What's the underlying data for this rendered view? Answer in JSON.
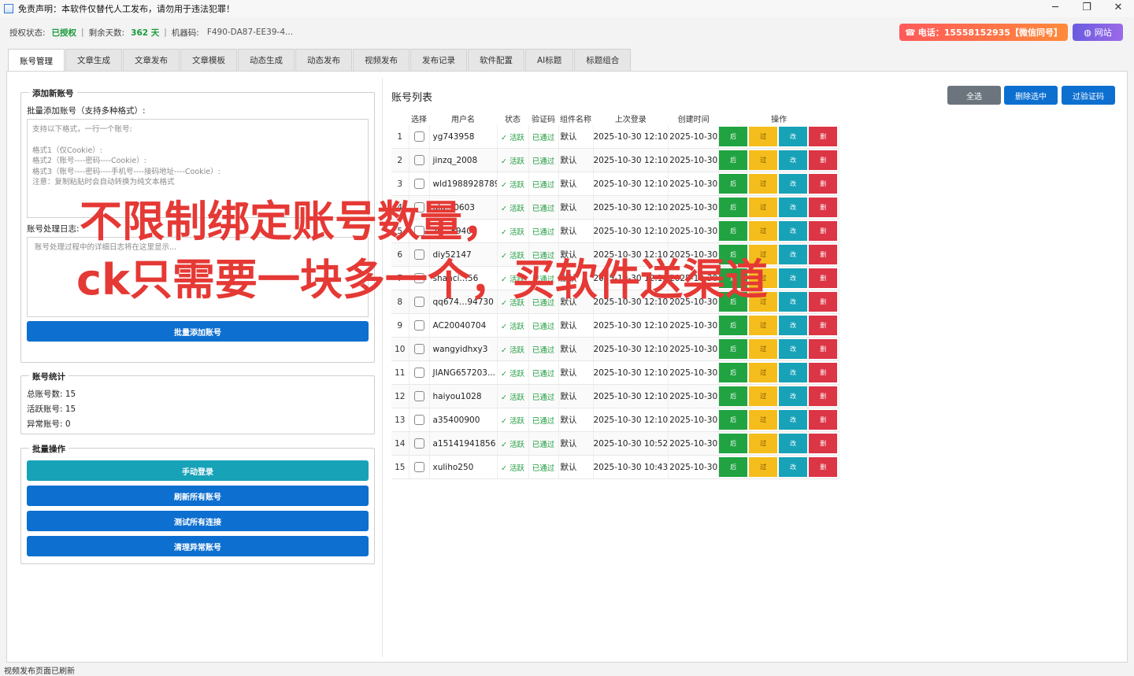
{
  "window": {
    "title": "免责声明：本软件仅替代人工发布，请勿用于违法犯罪！",
    "minimize": "─",
    "maximize": "❐",
    "close": "✕"
  },
  "status": {
    "auth_label": "授权状态:",
    "auth_value": "已授权",
    "days_label": "剩余天数:",
    "days_value": "362 天",
    "machine_label": "机器码:",
    "machine_value": "F490-DA87-EE39-4...",
    "phone_button": "电话：15558152935【微信同号】",
    "site_button": "网站"
  },
  "tabs": [
    "账号管理",
    "文章生成",
    "文章发布",
    "文章模板",
    "动态生成",
    "动态发布",
    "视频发布",
    "发布记录",
    "软件配置",
    "AI标题",
    "标题组合"
  ],
  "left": {
    "add_group": "添加新账号",
    "batch_label": "批量添加账号（支持多种格式）:",
    "batch_placeholder_lines": [
      "支持以下格式，一行一个账号:",
      "",
      "格式1（仅Cookie）:",
      "格式2（账号----密码----Cookie）:",
      "格式3（账号----密码----手机号----接码地址----Cookie）:",
      "注意：复制粘贴时会自动转换为纯文本格式"
    ],
    "log_label": "账号处理日志:",
    "log_placeholder": "账号处理过程中的详细日志将在这里显示...",
    "batch_add_button": "批量添加账号",
    "stats_group": "账号统计",
    "total": "总账号数: 15",
    "active": "活跃账号: 15",
    "abnormal": "异常账号: 0",
    "ops_group": "批量操作",
    "manual_login": "手动登录",
    "refresh_all": "刷新所有账号",
    "test_all": "测试所有连接",
    "clean_abnormal": "清理异常账号"
  },
  "right": {
    "title": "账号列表",
    "select_all": "全选",
    "delete_selected": "删除选中",
    "pass_captcha": "过验证码",
    "columns": [
      "选择",
      "用户名",
      "状态",
      "验证码",
      "组件名称",
      "上次登录",
      "创建时间",
      "操作"
    ],
    "rows": [
      {
        "idx": "1",
        "user": "yg743958",
        "status": "✓ 活跃",
        "verify": "已通过",
        "comp": "默认",
        "login": "2025-10-30 12:10",
        "created": "2025-10-30"
      },
      {
        "idx": "2",
        "user": "jinzq_2008",
        "status": "✓ 活跃",
        "verify": "已通过",
        "comp": "默认",
        "login": "2025-10-30 12:10",
        "created": "2025-10-30"
      },
      {
        "idx": "3",
        "user": "wld1988928789",
        "status": "✓ 活跃",
        "verify": "已通过",
        "comp": "默认",
        "login": "2025-10-30 12:10",
        "created": "2025-10-30"
      },
      {
        "idx": "4",
        "user": "ulu…0603",
        "status": "✓ 活跃",
        "verify": "已通过",
        "comp": "默认",
        "login": "2025-10-30 12:10",
        "created": "2025-10-30"
      },
      {
        "idx": "5",
        "user": "zh…8940",
        "status": "✓ 活跃",
        "verify": "已通过",
        "comp": "默认",
        "login": "2025-10-30 12:10",
        "created": "2025-10-30"
      },
      {
        "idx": "6",
        "user": "diy52147",
        "status": "✓ 活跃",
        "verify": "已通过",
        "comp": "默认",
        "login": "2025-10-30 12:10",
        "created": "2025-10-30"
      },
      {
        "idx": "7",
        "user": "shanci…56",
        "status": "✓ 活跃",
        "verify": "已通过",
        "comp": "默认",
        "login": "2025-10-30 12:10",
        "created": "2025-10-30"
      },
      {
        "idx": "8",
        "user": "qq674…94730",
        "status": "✓ 活跃",
        "verify": "已通过",
        "comp": "默认",
        "login": "2025-10-30 12:10",
        "created": "2025-10-30"
      },
      {
        "idx": "9",
        "user": "AC20040704",
        "status": "✓ 活跃",
        "verify": "已通过",
        "comp": "默认",
        "login": "2025-10-30 12:10",
        "created": "2025-10-30"
      },
      {
        "idx": "10",
        "user": "wangyidhxy3",
        "status": "✓ 活跃",
        "verify": "已通过",
        "comp": "默认",
        "login": "2025-10-30 12:10",
        "created": "2025-10-30"
      },
      {
        "idx": "11",
        "user": "JIANG657203...",
        "status": "✓ 活跃",
        "verify": "已通过",
        "comp": "默认",
        "login": "2025-10-30 12:10",
        "created": "2025-10-30"
      },
      {
        "idx": "12",
        "user": "haiyou1028",
        "status": "✓ 活跃",
        "verify": "已通过",
        "comp": "默认",
        "login": "2025-10-30 12:10",
        "created": "2025-10-30"
      },
      {
        "idx": "13",
        "user": "a35400900",
        "status": "✓ 活跃",
        "verify": "已通过",
        "comp": "默认",
        "login": "2025-10-30 12:10",
        "created": "2025-10-30"
      },
      {
        "idx": "14",
        "user": "a15141941856",
        "status": "✓ 活跃",
        "verify": "已通过",
        "comp": "默认",
        "login": "2025-10-30 10:52",
        "created": "2025-10-30"
      },
      {
        "idx": "15",
        "user": "xuliho250",
        "status": "✓ 活跃",
        "verify": "已通过",
        "comp": "默认",
        "login": "2025-10-30 10:43",
        "created": "2025-10-30"
      }
    ],
    "op_labels": [
      "后",
      "过",
      "改",
      "删"
    ]
  },
  "overlay": {
    "line1": "不限制绑定账号数量，",
    "line2": "ck只需要一块多一个，买软件送渠道"
  },
  "footer": "视频发布页面已刷新",
  "icons": {
    "phone": "phone-icon",
    "globe": "globe-icon",
    "app": "app-icon"
  },
  "colors": {
    "active_green": "#1a9a3a",
    "primary_blue": "#0d6fd0",
    "teal": "#17a2b8",
    "danger": "#dc3545",
    "warning": "#f5bd1c",
    "overlay_red": "#e53935"
  }
}
